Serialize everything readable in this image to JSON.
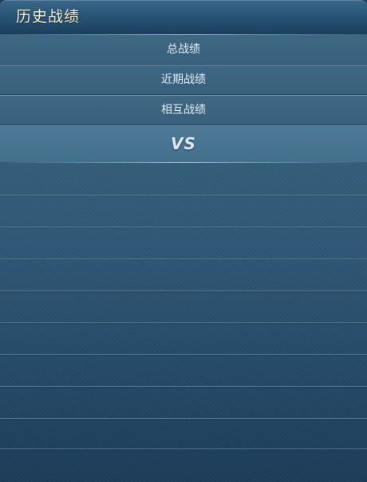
{
  "header": {
    "title": "历史战绩"
  },
  "tabs": [
    {
      "label": "总战绩"
    },
    {
      "label": "近期战绩"
    },
    {
      "label": "相互战绩"
    }
  ],
  "matchup": {
    "vs_label": "VS"
  },
  "colors": {
    "title_text": "#f3ecc6",
    "accent_line": "#d6c47a",
    "panel_top": "#3d6783",
    "panel_bottom": "#1c3c59"
  }
}
